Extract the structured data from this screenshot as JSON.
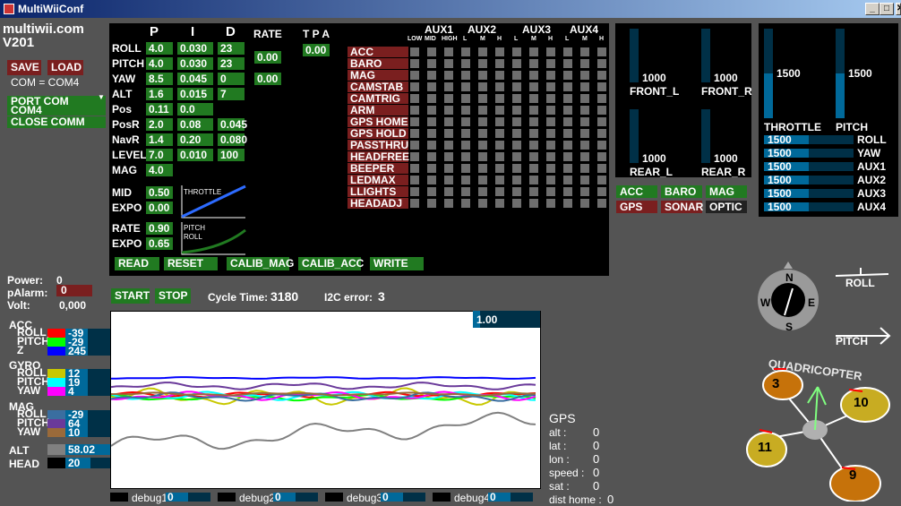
{
  "window": {
    "title": "MultiWiiConf",
    "min": "_",
    "max": "□",
    "close": "✕"
  },
  "brand": {
    "site": "multiwii.com",
    "version": "V201"
  },
  "conn": {
    "save": "SAVE",
    "load": "LOAD",
    "com_status": "COM = COM4",
    "port_dropdown": "PORT COM",
    "port_selected": "COM4",
    "close": "CLOSE COMM"
  },
  "pid": {
    "headers": {
      "p": "P",
      "i": "I",
      "d": "D",
      "rate": "RATE",
      "tpa": "T P A"
    },
    "rows": [
      {
        "label": "ROLL",
        "p": "4.0",
        "i": "0.030",
        "d": "23"
      },
      {
        "label": "PITCH",
        "p": "4.0",
        "i": "0.030",
        "d": "23"
      },
      {
        "label": "YAW",
        "p": "8.5",
        "i": "0.045",
        "d": "0"
      },
      {
        "label": "ALT",
        "p": "1.6",
        "i": "0.015",
        "d": "7"
      },
      {
        "label": "Pos",
        "p": "0.11",
        "i": "0.0",
        "d": ""
      },
      {
        "label": "PosR",
        "p": "2.0",
        "i": "0.08",
        "d": "0.045"
      },
      {
        "label": "NavR",
        "p": "1.4",
        "i": "0.20",
        "d": "0.080"
      },
      {
        "label": "LEVEL",
        "p": "7.0",
        "i": "0.010",
        "d": "100"
      },
      {
        "label": "MAG",
        "p": "4.0",
        "i": "",
        "d": ""
      }
    ],
    "rate_rollpitch": "0.00",
    "rate_yaw": "0.00",
    "tpa": "0.00",
    "mid_label": "MID",
    "mid": "0.50",
    "expo_label": "EXPO",
    "expo": "0.00",
    "rc_rate_label": "RATE",
    "rc_rate": "0.90",
    "rc_expo_label": "EXPO",
    "rc_expo": "0.65",
    "throttle_curve_label": "THROTTLE",
    "pitchroll_curve_label1": "PITCH",
    "pitchroll_curve_label2": "ROLL",
    "buttons": [
      "READ",
      "RESET",
      "CALIB_MAG",
      "CALIB_ACC",
      "WRITE"
    ]
  },
  "aux": {
    "groups": [
      "AUX1",
      "AUX2",
      "AUX3",
      "AUX4"
    ],
    "sub": [
      "LOW",
      "MID",
      "HIGH",
      "L",
      "M",
      "H",
      "L",
      "M",
      "H",
      "L",
      "M",
      "H"
    ],
    "modes": [
      "ACC",
      "BARO",
      "MAG",
      "CAMSTAB",
      "CAMTRIG",
      "ARM",
      "GPS HOME",
      "GPS HOLD",
      "PASSTHRU",
      "HEADFREE",
      "BEEPER",
      "LEDMAX",
      "LLIGHTS",
      "HEADADJ"
    ]
  },
  "motors": [
    {
      "label": "FRONT_L",
      "value": "1000"
    },
    {
      "label": "FRONT_R",
      "value": "1000"
    },
    {
      "label": "REAR_L",
      "value": "1000"
    },
    {
      "label": "REAR_R",
      "value": "1000"
    }
  ],
  "sensors": [
    {
      "label": "ACC",
      "state": "on"
    },
    {
      "label": "BARO",
      "state": "on"
    },
    {
      "label": "MAG",
      "state": "on"
    },
    {
      "label": "GPS",
      "state": "off"
    },
    {
      "label": "SONAR",
      "state": "off"
    },
    {
      "label": "OPTIC",
      "state": "none"
    }
  ],
  "rc": {
    "throttle": {
      "label": "THROTTLE",
      "value": "1500",
      "level": 0.5
    },
    "pitch": {
      "label": "PITCH",
      "value": "1500",
      "level": 0.5
    },
    "channels": [
      {
        "label": "ROLL",
        "value": "1500",
        "level": 0.5
      },
      {
        "label": "YAW",
        "value": "1500",
        "level": 0.5
      },
      {
        "label": "AUX1",
        "value": "1500",
        "level": 0.5
      },
      {
        "label": "AUX2",
        "value": "1500",
        "level": 0.5
      },
      {
        "label": "AUX3",
        "value": "1500",
        "level": 0.5
      },
      {
        "label": "AUX4",
        "value": "1500",
        "level": 0.5
      }
    ]
  },
  "power": {
    "power_label": "Power:",
    "power": "0",
    "alarm_label": "pAlarm:",
    "alarm": "0",
    "volt_label": "Volt:",
    "volt": "0,000"
  },
  "sensor_readout": [
    {
      "group": "ACC",
      "rows": [
        {
          "label": "ROLL",
          "value": "-39",
          "color": "#ff0000"
        },
        {
          "label": "PITCH",
          "value": "-29",
          "color": "#00ff00"
        },
        {
          "label": "Z",
          "value": "245",
          "color": "#0000ff"
        }
      ]
    },
    {
      "group": "GYRO",
      "rows": [
        {
          "label": "ROLL",
          "value": "12",
          "color": "#c8c800"
        },
        {
          "label": "PITCH",
          "value": "19",
          "color": "#00ffff"
        },
        {
          "label": "YAW",
          "value": "4",
          "color": "#ff00ff"
        }
      ]
    },
    {
      "group": "MAG",
      "rows": [
        {
          "label": "ROLL",
          "value": "-29",
          "color": "#3a6ea0"
        },
        {
          "label": "PITCH",
          "value": "64",
          "color": "#6a3a9a"
        },
        {
          "label": "YAW",
          "value": "10",
          "color": "#9a6a3a"
        }
      ]
    }
  ],
  "alt": {
    "label": "ALT",
    "value": "58.02",
    "color": "#808080"
  },
  "head": {
    "label": "HEAD",
    "value": "20",
    "color": "#000000"
  },
  "graph": {
    "start": "START",
    "stop": "STOP",
    "cycle_label": "Cycle Time:",
    "cycle": "3180",
    "i2c_label": "I2C error:",
    "i2c": "3",
    "scale": "1.00"
  },
  "debug": [
    {
      "label": "debug1",
      "value": "0"
    },
    {
      "label": "debug2",
      "value": "0"
    },
    {
      "label": "debug3",
      "value": "0"
    },
    {
      "label": "debug4",
      "value": "0"
    }
  ],
  "gps": {
    "title": "GPS",
    "rows": [
      {
        "label": "alt  :",
        "value": "0"
      },
      {
        "label": "lat  :",
        "value": "0"
      },
      {
        "label": "lon  :",
        "value": "0"
      },
      {
        "label": "speed :",
        "value": "0"
      },
      {
        "label": "sat  :",
        "value": "0"
      },
      {
        "label": "dist home :",
        "value": "0"
      }
    ]
  },
  "compass": {
    "n": "N",
    "s": "S",
    "e": "E",
    "w": "W"
  },
  "attitude": {
    "roll": "ROLL",
    "pitch": "PITCH"
  },
  "quad": {
    "title": "QUADRICOPTER",
    "motors": [
      "3",
      "10",
      "11",
      "9"
    ]
  }
}
